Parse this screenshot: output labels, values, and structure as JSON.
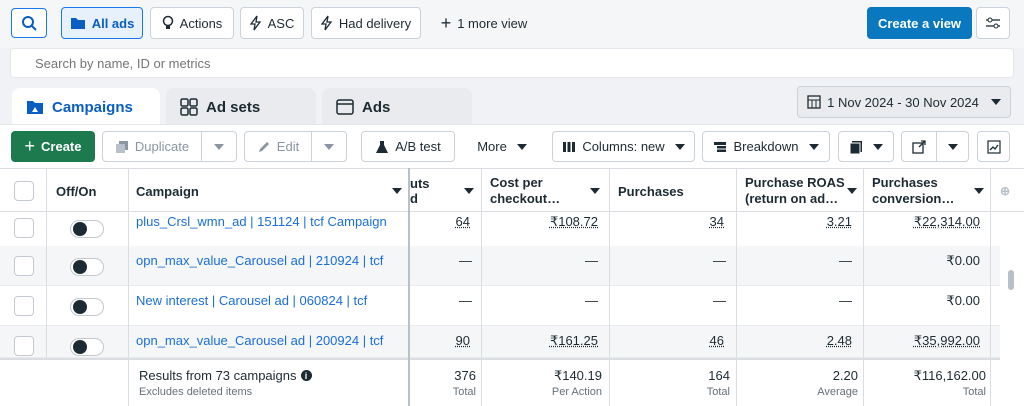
{
  "views": {
    "all_ads": "All ads",
    "actions": "Actions",
    "asc": "ASC",
    "had_delivery": "Had delivery",
    "more_view": "1 more view",
    "create_view": "Create a view"
  },
  "search": {
    "placeholder": "Search by name, ID or metrics"
  },
  "tabs": {
    "campaigns": "Campaigns",
    "ad_sets": "Ad sets",
    "ads": "Ads"
  },
  "date_range": "1 Nov 2024 - 30 Nov 2024",
  "toolbar": {
    "create": "Create",
    "duplicate": "Duplicate",
    "edit": "Edit",
    "ab_test": "A/B test",
    "more": "More",
    "columns": "Columns: new",
    "breakdown": "Breakdown"
  },
  "columns": {
    "off_on": "Off/On",
    "campaign": "Campaign",
    "checkouts_l1": "uts",
    "checkouts_l2": "d",
    "cost_per_checkout_l1": "Cost per",
    "cost_per_checkout_l2": "checkout…",
    "purchases": "Purchases",
    "roas_l1": "Purchase ROAS",
    "roas_l2": "(return on ad…",
    "conv_l1": "Purchases",
    "conv_l2": "conversion…"
  },
  "rows": [
    {
      "campaign": "plus_Crsl_wmn_ad | 151124 | tcf Campaign",
      "checkouts": "64",
      "cost": "₹108.72",
      "purchases": "34",
      "roas": "3.21",
      "conv": "₹22,314.00"
    },
    {
      "campaign": "opn_max_value_Carousel ad | 210924 | tcf",
      "checkouts": "—",
      "cost": "—",
      "purchases": "—",
      "roas": "—",
      "conv": "₹0.00"
    },
    {
      "campaign": "New interest | Carousel ad | 060824 | tcf",
      "checkouts": "—",
      "cost": "—",
      "purchases": "—",
      "roas": "—",
      "conv": "₹0.00"
    },
    {
      "campaign": "opn_max_value_Carousel ad | 200924 | tcf",
      "checkouts": "90",
      "cost": "₹161.25",
      "purchases": "46",
      "roas": "2.48",
      "conv": "₹35,992.00"
    }
  ],
  "footer": {
    "results": "Results from 73 campaigns",
    "excludes": "Excludes deleted items",
    "checkouts": "376",
    "checkouts_sub": "Total",
    "cost": "₹140.19",
    "cost_sub": "Per Action",
    "purchases": "164",
    "purchases_sub": "Total",
    "roas": "2.20",
    "roas_sub": "Average",
    "conv": "₹116,162.00",
    "conv_sub": "Total"
  },
  "colors": {
    "accent": "#0a78be",
    "create_green": "#1d7a4e",
    "link": "#1a6ed8"
  }
}
